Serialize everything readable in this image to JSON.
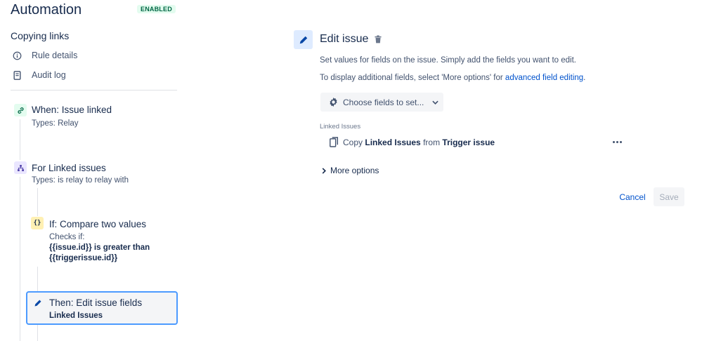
{
  "app": {
    "title": "Automation",
    "status_badge": "ENABLED"
  },
  "rule": {
    "name": "Copying links",
    "nav": [
      {
        "label": "Rule details",
        "icon": "info-icon"
      },
      {
        "label": "Audit log",
        "icon": "document-icon"
      }
    ]
  },
  "steps": {
    "trigger": {
      "title": "When: Issue linked",
      "subtitle": "Types: Relay",
      "icon": "link-icon"
    },
    "branch": {
      "title": "For Linked issues",
      "subtitle": "Types: is relay to relay with",
      "icon": "branch-icon"
    },
    "condition": {
      "title": "If: Compare two values",
      "line1": "Checks if:",
      "line2": "{{issue.id}} is greater than",
      "line3": "{{triggerissue.id}}",
      "icon_text": "{}"
    },
    "action": {
      "title": "Then: Edit issue fields",
      "subtitle": "Linked Issues",
      "icon": "pencil-icon"
    }
  },
  "panel": {
    "title": "Edit issue",
    "desc1": "Set values for fields on the issue. Simply add the fields you want to edit.",
    "desc2_prefix": "To display additional fields, select 'More options' for ",
    "desc2_link": "advanced field editing",
    "desc2_suffix": ".",
    "choose_fields_label": "Choose fields to set...",
    "field_label": "Linked Issues",
    "copy_prefix": "Copy ",
    "copy_field": "Linked Issues",
    "copy_middle": " from ",
    "copy_source": "Trigger issue",
    "more_options_label": "More options",
    "cancel_label": "Cancel",
    "save_label": "Save"
  },
  "colors": {
    "accent": "#0052cc",
    "badge_bg": "#e3fcef",
    "badge_text": "#006644",
    "selected_border": "#4c9aff"
  }
}
